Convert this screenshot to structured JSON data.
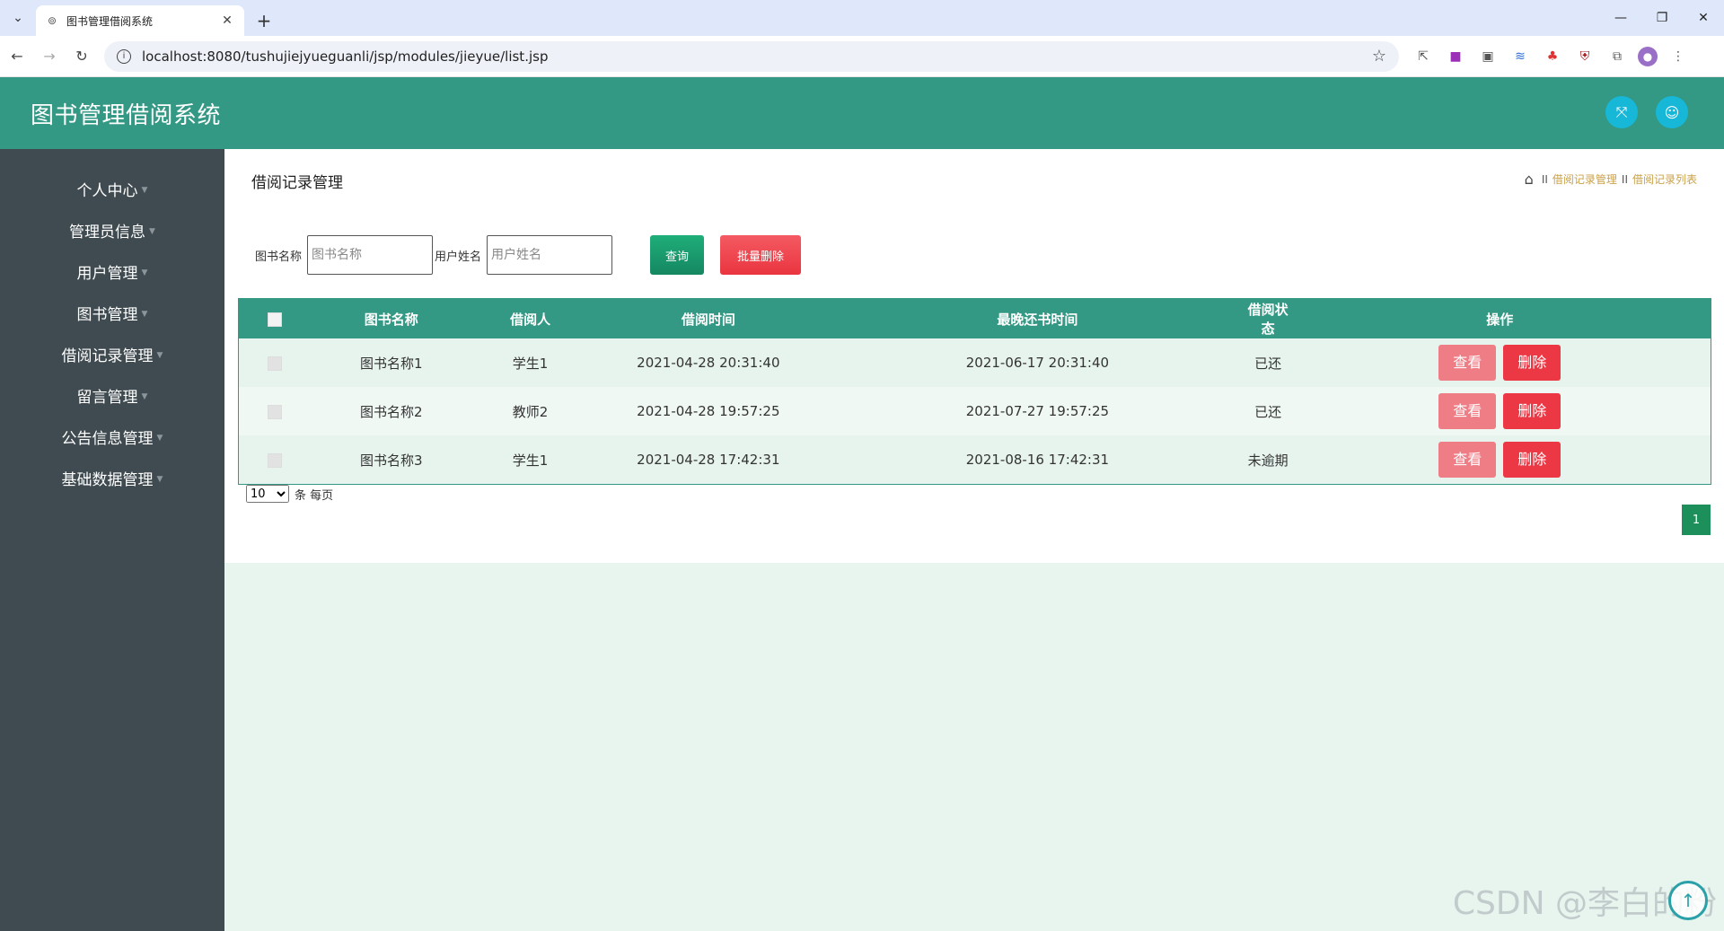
{
  "browser": {
    "tab_title": "图书管理借阅系统",
    "url": "localhost:8080/tushujiejyueguanli/jsp/modules/jieyue/list.jsp"
  },
  "header": {
    "title": "图书管理借阅系统"
  },
  "sidebar": {
    "items": [
      {
        "label": "个人中心"
      },
      {
        "label": "管理员信息"
      },
      {
        "label": "用户管理"
      },
      {
        "label": "图书管理"
      },
      {
        "label": "借阅记录管理"
      },
      {
        "label": "留言管理"
      },
      {
        "label": "公告信息管理"
      },
      {
        "label": "基础数据管理"
      }
    ]
  },
  "page": {
    "title": "借阅记录管理",
    "breadcrumb": [
      "借阅记录管理",
      "借阅记录列表"
    ],
    "breadcrumb_sep": "II"
  },
  "search": {
    "book_label": "图书名称",
    "book_placeholder": "图书名称",
    "user_label": "用户姓名",
    "user_placeholder": "用户姓名",
    "query_label": "查询",
    "batch_delete_label": "批量删除"
  },
  "table": {
    "columns": [
      "图书名称",
      "借阅人",
      "借阅时间",
      "最晚还书时间",
      "借阅状态",
      "操作"
    ],
    "rows": [
      {
        "book": "图书名称1",
        "borrower": "学生1",
        "borrow_time": "2021-04-28 20:31:40",
        "due_time": "2021-06-17 20:31:40",
        "status": "已还"
      },
      {
        "book": "图书名称2",
        "borrower": "教师2",
        "borrow_time": "2021-04-28 19:57:25",
        "due_time": "2021-07-27 19:57:25",
        "status": "已还"
      },
      {
        "book": "图书名称3",
        "borrower": "学生1",
        "borrow_time": "2021-04-28 17:42:31",
        "due_time": "2021-08-16 17:42:31",
        "status": "未逾期"
      }
    ],
    "view_label": "查看",
    "delete_label": "删除"
  },
  "pagination": {
    "page_size": "10",
    "page_size_suffix": "条 每页",
    "current_page": "1"
  },
  "watermark": "CSDN @李白的粉"
}
